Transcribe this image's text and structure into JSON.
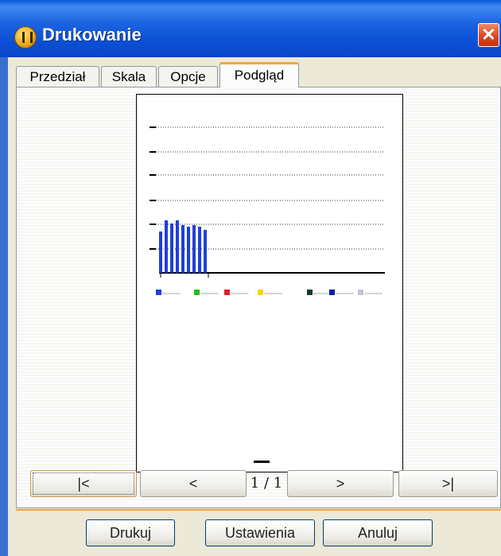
{
  "window": {
    "title": "Drukowanie",
    "close_label": "✕"
  },
  "tabs": [
    {
      "label": "Przedział"
    },
    {
      "label": "Skala"
    },
    {
      "label": "Opcje"
    },
    {
      "label": "Podgląd"
    }
  ],
  "active_tab": "Podgląd",
  "preview": {
    "chart_bar_color": "#1f3fd8",
    "legend_colors": [
      "#1f3fd8",
      "#20c020",
      "#e02020",
      "#f0d800",
      "#123c2a",
      "#0a1fb0",
      "#c8c0d8"
    ]
  },
  "navigation": {
    "first_label": "|<",
    "prev_label": "<",
    "page_indicator": "1 / 1",
    "next_label": ">",
    "last_label": ">|"
  },
  "buttons": {
    "print_label": "Drukuj",
    "settings_label": "Ustawienia",
    "cancel_label": "Anuluj"
  }
}
